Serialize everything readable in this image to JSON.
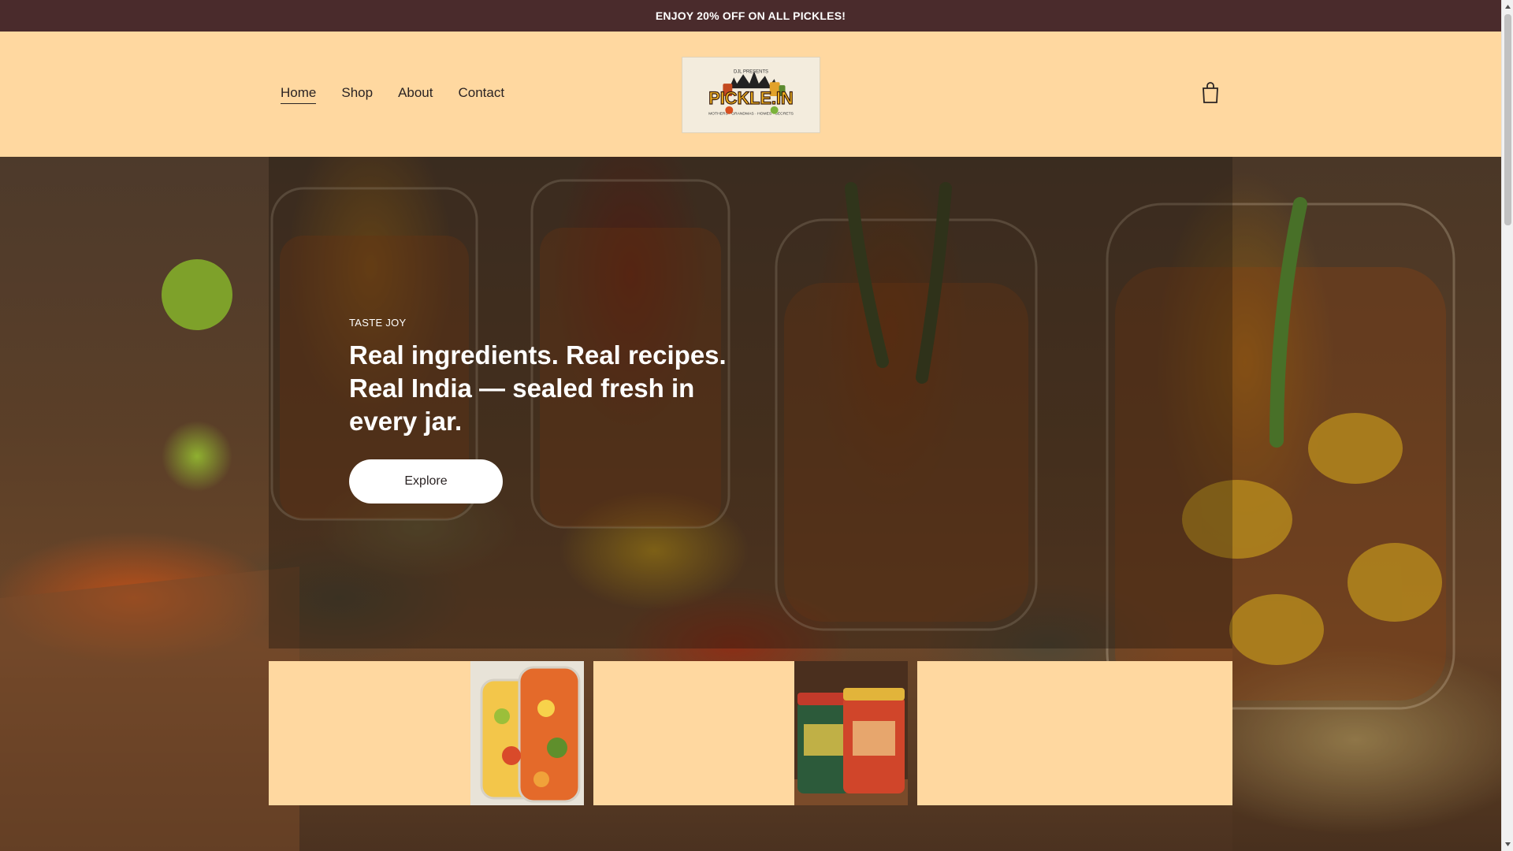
{
  "announcement": {
    "text": "ENJOY 20% OFF ON ALL PICKLES!"
  },
  "header": {
    "nav": [
      {
        "label": "Home",
        "active": true
      },
      {
        "label": "Shop",
        "active": false
      },
      {
        "label": "About",
        "active": false
      },
      {
        "label": "Contact",
        "active": false
      }
    ],
    "logo": {
      "top_text": "DJL PRESENTS",
      "brand_text": "PICKLE.IN",
      "tagline": "MOTHERS · GRANDMAS · HOMES · SECRETS"
    },
    "cart_icon": "shopping-bag-icon"
  },
  "hero": {
    "eyebrow": "TASTE JOY",
    "headline": "Real ingredients. Real recipes. Real India — sealed fresh in every jar.",
    "button_label": "Explore"
  },
  "cards": [
    {
      "image": "mixed-vegetable-pickle-jars"
    },
    {
      "image": "branded-pickle-jars"
    },
    {
      "image": ""
    }
  ],
  "colors": {
    "announcement_bg": "#4a2b2c",
    "header_bg": "#ffd8a0",
    "card_bg": "#ffd8a0",
    "button_bg": "#ffffff",
    "text_dark": "#2a2323"
  }
}
